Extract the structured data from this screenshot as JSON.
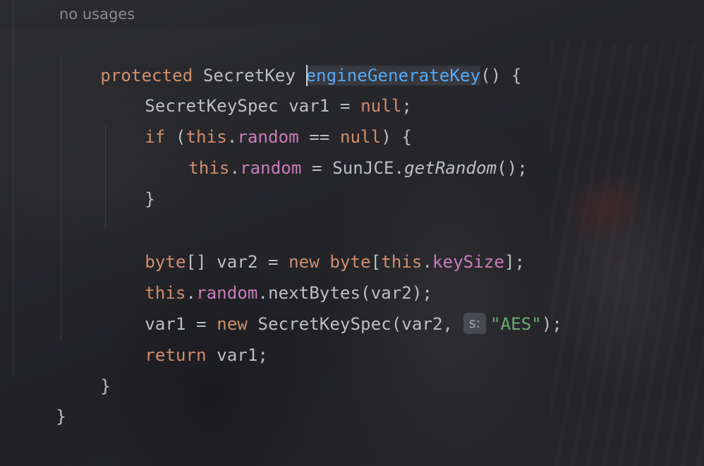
{
  "editor": {
    "usage_hint": "no usages",
    "lines": [
      {
        "tokens": [
          [
            "kw",
            "protected"
          ],
          [
            "pl",
            " SecretKey "
          ]
        ],
        "caret": true,
        "after_caret": [
          [
            "fn",
            "engineGenerateKey"
          ],
          [
            "pl",
            "() {"
          ]
        ]
      },
      {
        "tokens": [
          [
            "pl",
            "SecretKeySpec var1 = "
          ],
          [
            "kw",
            "null"
          ],
          [
            "pl",
            ";"
          ]
        ]
      },
      {
        "tokens": [
          [
            "kw",
            "if"
          ],
          [
            "pl",
            " ("
          ],
          [
            "kw",
            "this"
          ],
          [
            "pl",
            "."
          ],
          [
            "fld",
            "random"
          ],
          [
            "pl",
            " == "
          ],
          [
            "kw",
            "null"
          ],
          [
            "pl",
            ") {"
          ]
        ]
      },
      {
        "tokens": [
          [
            "kw",
            "this"
          ],
          [
            "pl",
            "."
          ],
          [
            "fld",
            "random"
          ],
          [
            "pl",
            " = SunJCE."
          ],
          [
            "it",
            "getRandom"
          ],
          [
            "pl",
            "();"
          ]
        ]
      },
      {
        "tokens": [
          [
            "pl",
            "}"
          ]
        ]
      },
      {
        "tokens": []
      },
      {
        "tokens": [
          [
            "kw",
            "byte"
          ],
          [
            "pl",
            "[] var2 = "
          ],
          [
            "kw",
            "new"
          ],
          [
            "pl",
            " "
          ],
          [
            "kw",
            "byte"
          ],
          [
            "pl",
            "["
          ],
          [
            "kw",
            "this"
          ],
          [
            "pl",
            "."
          ],
          [
            "fld",
            "keySize"
          ],
          [
            "pl",
            "];"
          ]
        ]
      },
      {
        "tokens": [
          [
            "kw",
            "this"
          ],
          [
            "pl",
            "."
          ],
          [
            "fld",
            "random"
          ],
          [
            "pl",
            ".nextBytes(var2);"
          ]
        ]
      },
      {
        "tokens": [
          [
            "pl",
            "var1 = "
          ],
          [
            "kw",
            "new"
          ],
          [
            "pl",
            " SecretKeySpec(var2, "
          ],
          [
            "hint",
            "s:"
          ],
          [
            "str",
            "\"AES\""
          ],
          [
            "pl",
            ");"
          ]
        ]
      },
      {
        "tokens": [
          [
            "kw",
            "return"
          ],
          [
            "pl",
            " var1;"
          ]
        ]
      },
      {
        "tokens": [
          [
            "pl",
            "}"
          ]
        ]
      },
      {
        "tokens": [
          [
            "pl",
            "}"
          ]
        ]
      }
    ]
  }
}
